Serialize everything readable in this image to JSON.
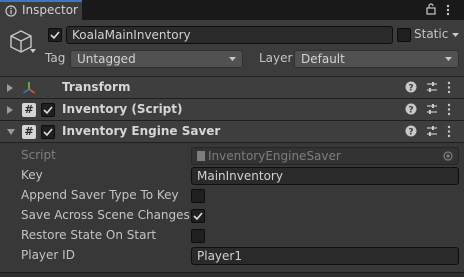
{
  "tab": {
    "title": "Inspector",
    "icon": "info-icon"
  },
  "gameobject": {
    "active": true,
    "name": "KoalaMainInventory",
    "static_label": "Static",
    "static_checked": false,
    "tag_label": "Tag",
    "tag_value": "Untagged",
    "layer_label": "Layer",
    "layer_value": "Default"
  },
  "components": [
    {
      "title": "Transform",
      "icon": "transform-icon",
      "has_checkbox": false
    },
    {
      "title": "Inventory (Script)",
      "icon": "script-icon",
      "has_checkbox": true,
      "enabled": true
    },
    {
      "title": "Inventory Engine Saver",
      "icon": "script-icon",
      "has_checkbox": true,
      "enabled": true,
      "expanded": true
    }
  ],
  "saver_fields": {
    "script_label": "Script",
    "script_value": "InventoryEngineSaver",
    "key_label": "Key",
    "key_value": "MainInventory",
    "append_label": "Append Saver Type To Key",
    "append_checked": false,
    "save_across_label": "Save Across Scene Changes",
    "save_across_checked": true,
    "restore_label": "Restore State On Start",
    "restore_checked": false,
    "player_id_label": "Player ID",
    "player_id_value": "Player1"
  },
  "colors": {
    "accent": "#3a79bb",
    "panel": "#383838",
    "header": "#3e3e3e"
  }
}
